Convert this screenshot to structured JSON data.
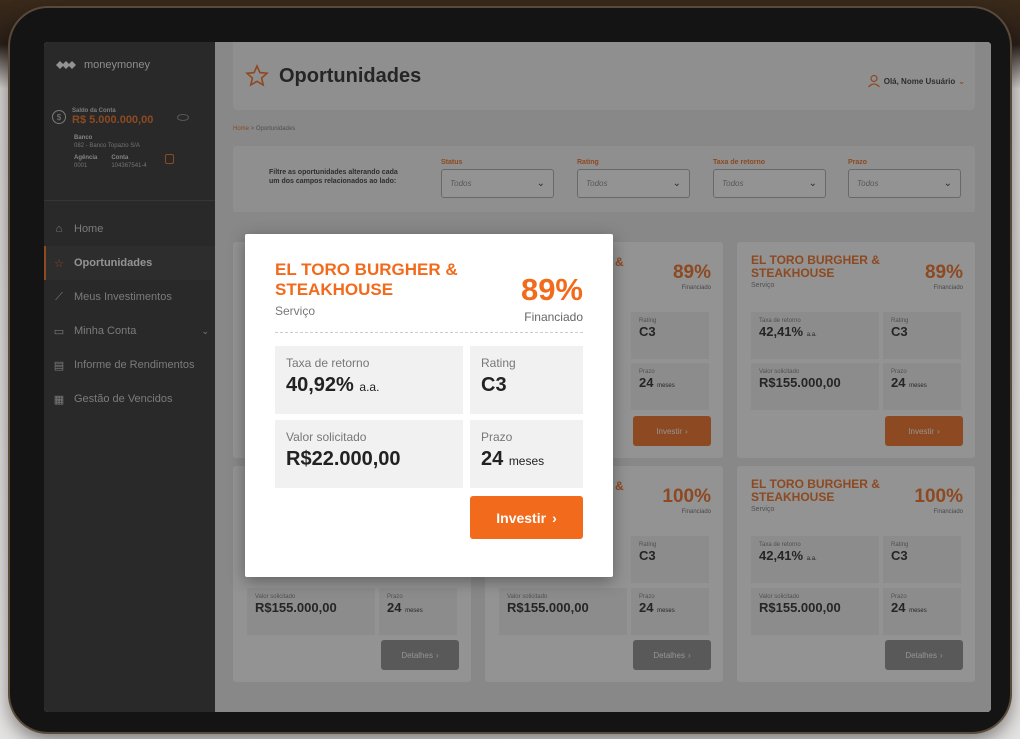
{
  "app": {
    "brand": "moneymoney",
    "accent_color": "#f26a1b"
  },
  "sidebar": {
    "balance_label": "Saldo da Conta",
    "balance_value": "R$ 5.000.000,00",
    "bank_label": "Banco",
    "bank_value": "082 - Banco Topazio S/A",
    "agency_label": "Agência",
    "agency_value": "0001",
    "account_label": "Conta",
    "account_value": "104367541-4",
    "items": [
      {
        "label": "Home",
        "icon": "home-icon"
      },
      {
        "label": "Oportunidades",
        "icon": "star-icon",
        "active": true
      },
      {
        "label": "Meus Investimentos",
        "icon": "chart-line-icon"
      },
      {
        "label": "Minha Conta",
        "icon": "account-icon"
      },
      {
        "label": "Informe de Rendimentos",
        "icon": "report-icon"
      },
      {
        "label": "Gestão de Vencidos",
        "icon": "calendar-icon"
      }
    ]
  },
  "header": {
    "title": "Oportunidades",
    "user_greeting": "Olá, Nome Usuário"
  },
  "breadcrumb": {
    "home": "Home",
    "current": "Oportunidades"
  },
  "filters": {
    "description": "Filtre as oportunidades alterando cada um dos campos relacionados ao lado:",
    "status": {
      "label": "Status",
      "value": "Todos"
    },
    "rating": {
      "label": "Rating",
      "value": "Todos"
    },
    "taxa": {
      "label": "Taxa de retorno",
      "value": "Todos"
    },
    "prazo": {
      "label": "Prazo",
      "value": "Todos"
    }
  },
  "labels": {
    "financed": "Financiado",
    "taxa": "Taxa de retorno",
    "rating": "Rating",
    "valor": "Valor solicitado",
    "prazo": "Prazo",
    "aa": "a.a.",
    "meses": "meses",
    "invest": "Investir",
    "details": "Detalhes",
    "ampersand": "&"
  },
  "cards": [
    {
      "name": "EL TORO BURGHER & STEAKHOUSE",
      "category": "Serviço",
      "pct": "89%",
      "taxa": "42,41%",
      "rating": "C3",
      "valor": "R$155.000,00",
      "prazo": "24"
    },
    {
      "name": "EL TORO BURGHER & STEAKHOUSE",
      "category": "Serviço",
      "pct": "100%",
      "taxa": "42,41%",
      "rating": "C3",
      "valor": "R$155.000,00",
      "prazo": "24"
    }
  ],
  "partial_cards": {
    "pct_top": "89%",
    "pct_bottom": "100%",
    "rating": "C3",
    "prazo": "24",
    "valor": "R$155.000,00"
  },
  "modal": {
    "name": "EL TORO BURGHER & STEAKHOUSE",
    "category": "Serviço",
    "pct": "89%",
    "taxa": "40,92%",
    "rating": "C3",
    "valor": "R$22.000,00",
    "prazo": "24"
  }
}
